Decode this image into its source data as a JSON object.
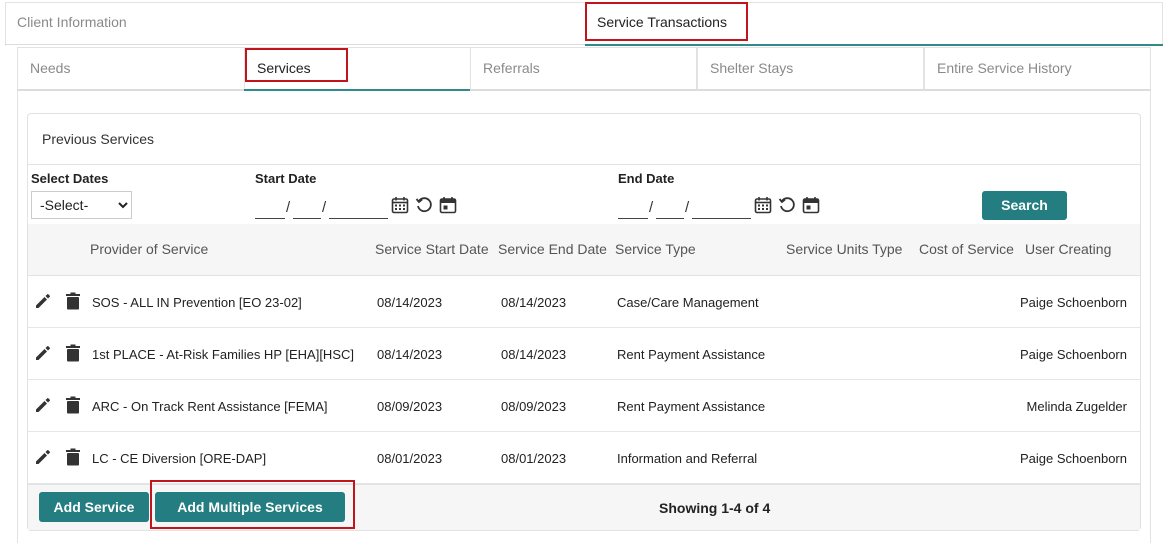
{
  "top_tabs": [
    {
      "label": "Client Information"
    },
    {
      "label": "Service Transactions"
    }
  ],
  "sub_tabs": [
    {
      "label": "Needs"
    },
    {
      "label": "Services"
    },
    {
      "label": "Referrals"
    },
    {
      "label": "Shelter Stays"
    },
    {
      "label": "Entire Service History"
    }
  ],
  "panel": {
    "title": "Previous Services"
  },
  "filters": {
    "select_dates_label": "Select Dates",
    "select_dates_value": "-Select-",
    "start_date_label": "Start Date",
    "end_date_label": "End Date",
    "search_label": "Search"
  },
  "table": {
    "columns": [
      "Provider of Service",
      "Service Start Date",
      "Service End Date",
      "Service Type",
      "Service Units Type",
      "Cost of Service",
      "User Creating"
    ],
    "rows": [
      {
        "provider": "SOS - ALL IN Prevention [EO 23-02]",
        "start": "08/14/2023",
        "end": "08/14/2023",
        "type": "Case/Care Management",
        "user": "Paige Schoenborn"
      },
      {
        "provider": "1st PLACE - At-Risk Families HP [EHA][HSC]",
        "start": "08/14/2023",
        "end": "08/14/2023",
        "type": "Rent Payment Assistance",
        "user": "Paige Schoenborn"
      },
      {
        "provider": "ARC - On Track Rent Assistance [FEMA]",
        "start": "08/09/2023",
        "end": "08/09/2023",
        "type": "Rent Payment Assistance",
        "user": "Melinda Zugelder"
      },
      {
        "provider": "LC - CE Diversion [ORE-DAP]",
        "start": "08/01/2023",
        "end": "08/01/2023",
        "type": "Information and Referral",
        "user": "Paige Schoenborn"
      }
    ]
  },
  "footer": {
    "add_service": "Add Service",
    "add_multiple": "Add Multiple Services",
    "showing": "Showing 1-4 of 4"
  },
  "colors": {
    "accent": "#247d80",
    "highlight": "#c0151b"
  },
  "icons": [
    "pencil-icon",
    "trash-icon",
    "calendar-icon",
    "reset-icon"
  ]
}
